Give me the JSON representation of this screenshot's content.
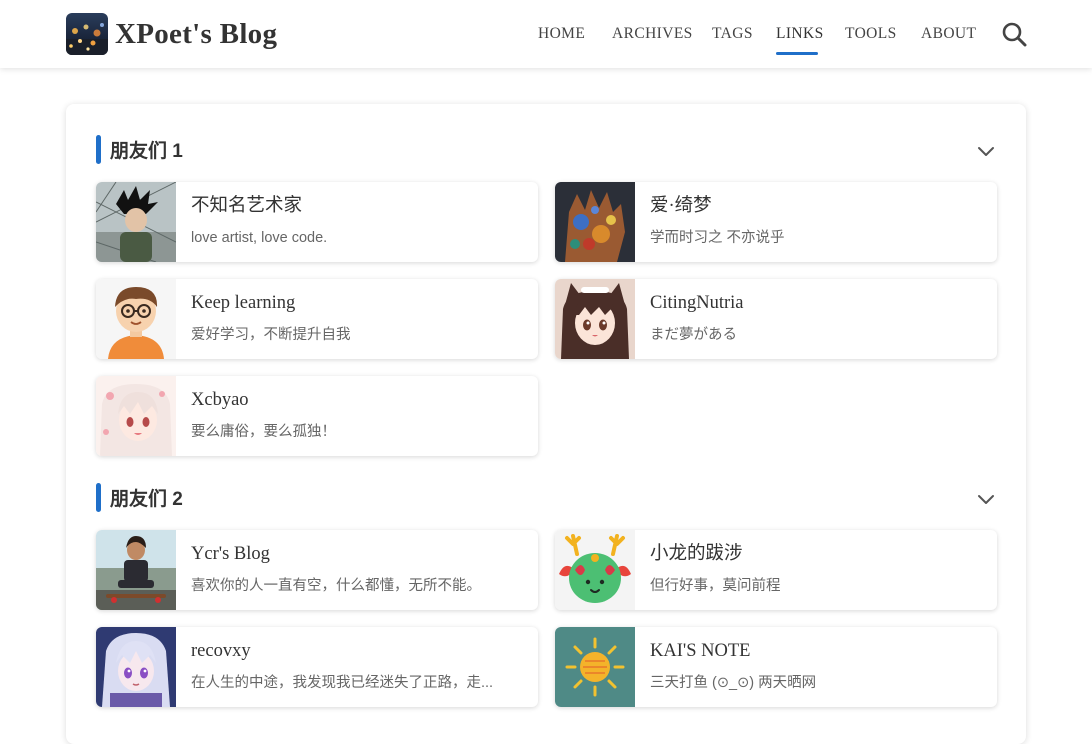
{
  "header": {
    "site_title": "XPoet's Blog",
    "logo_icon": "night-city-logo",
    "nav": [
      {
        "label": "HOME"
      },
      {
        "label": "ARCHIVES"
      },
      {
        "label": "TAGS"
      },
      {
        "label": "LINKS",
        "active": true
      },
      {
        "label": "TOOLS"
      },
      {
        "label": "ABOUT"
      }
    ],
    "search_icon": "search-icon"
  },
  "sections": [
    {
      "title": "朋友们 1",
      "links": [
        {
          "name": "不知名艺术家",
          "desc": "love artist, love code.",
          "avatar": "avatar-spiky-hair-photo"
        },
        {
          "name": "爱·绮梦",
          "desc": "学而时习之 不亦说乎",
          "avatar": "avatar-painted-hand"
        },
        {
          "name": "Keep learning",
          "desc": "爱好学习，不断提升自我",
          "avatar": "avatar-cartoon-glasses-boy"
        },
        {
          "name": "CitingNutria",
          "desc": "まだ夢がある",
          "avatar": "avatar-anime-cat-ears-girl"
        },
        {
          "name": "Xcbyao",
          "desc": "要么庸俗，要么孤独！",
          "avatar": "avatar-anime-white-hair-girl"
        }
      ]
    },
    {
      "title": "朋友们 2",
      "links": [
        {
          "name": "Ycr's Blog",
          "desc": "喜欢你的人一直有空，什么都懂，无所不能。",
          "avatar": "avatar-kid-on-skateboard"
        },
        {
          "name": "小龙的跋涉",
          "desc": "但行好事，莫问前程",
          "avatar": "avatar-green-dragon"
        },
        {
          "name": "recovxy",
          "desc": "在人生的中途，我发现我已经迷失了正路，走...",
          "avatar": "avatar-anime-purple-girl"
        },
        {
          "name": "KAI'S NOTE",
          "desc": "三天打鱼 (⊙_⊙) 两天晒网",
          "avatar": "avatar-sun-on-teal"
        }
      ]
    }
  ],
  "colors": {
    "accent": "#1f6fc9",
    "text": "#333333",
    "muted": "#666666",
    "background": "#ffffff"
  }
}
